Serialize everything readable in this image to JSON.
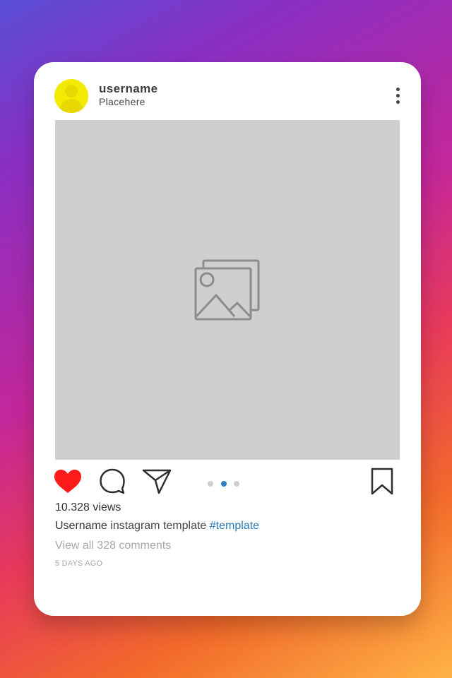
{
  "post": {
    "header": {
      "username": "username",
      "location": "Placehere",
      "avatar_icon": "user-avatar-icon",
      "more_icon": "more-vertical-icon"
    },
    "media": {
      "placeholder_icon": "image-placeholder-icon",
      "carousel_count": 3,
      "carousel_active_index": 1
    },
    "actions": {
      "like_icon": "heart-icon",
      "like_color": "#ff1a1a",
      "comment_icon": "comment-icon",
      "share_icon": "send-icon",
      "save_icon": "bookmark-icon"
    },
    "views": "10.328 views",
    "caption": {
      "username": "Username",
      "text": " instagram template ",
      "hashtag": "#template"
    },
    "view_comments": "View all 328 comments",
    "time_ago": "5 DAYS AGO"
  },
  "colors": {
    "avatar": "#f2ea00",
    "hashtag": "#2b79b8",
    "active_dot": "#2f7fc1",
    "like": "#ff1a1a"
  }
}
